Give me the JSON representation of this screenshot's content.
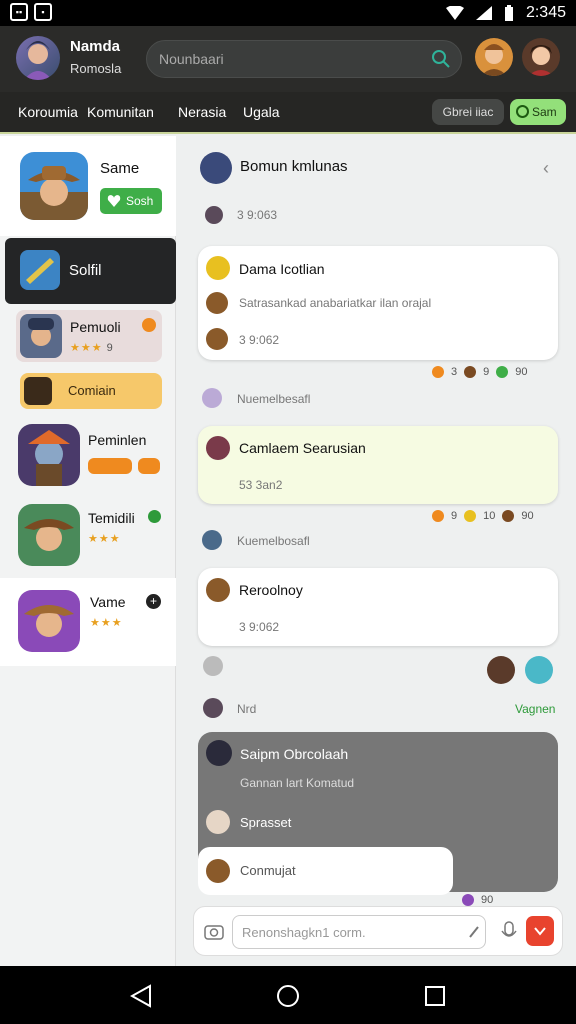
{
  "status": {
    "time": "2:345"
  },
  "header": {
    "title": "Namda",
    "subtitle": "Romosla",
    "search_placeholder": "Nounbaari"
  },
  "nav": {
    "tabs": [
      "Koroumia",
      "Komunitan",
      "Nerasia",
      "Ugala"
    ],
    "btn1": "Gbrei iiac",
    "btn2": "Sam"
  },
  "sidebar": {
    "items": [
      {
        "title": "Same",
        "badge": "Sosh"
      },
      {
        "title": "Solfil"
      },
      {
        "title": "Pemuoli",
        "rating": "9"
      },
      {
        "title": "Comiain"
      },
      {
        "title": "Peminlen"
      },
      {
        "title": "Temidili"
      },
      {
        "title": "Vame"
      }
    ]
  },
  "main": {
    "group_title": "Bomun kmlunas",
    "time1": "3 9:063",
    "msg1": {
      "title": "Dama Icotlian",
      "body": "Satrasankad anabariatkar ilan orajal",
      "time": "3 9:062"
    },
    "react1": [
      "3",
      "9",
      "90"
    ],
    "section2": "Nuemelbesafl",
    "msg2": {
      "title": "Camlaem Searusian",
      "time": "53 3an2"
    },
    "react2": [
      "9",
      "10",
      "90"
    ],
    "section3": "Kuemelbosafl",
    "msg3": {
      "title": "Reroolnoy",
      "time": "3 9:062"
    },
    "section4": "Nrd",
    "section4_link": "Vagnen",
    "msg4": {
      "title": "Saipm Obrcolaah",
      "body": "Gannan lart Komatud",
      "reply": "Sprasset"
    },
    "msg5": "Conmujat",
    "react5": "90",
    "composer_placeholder": "Renonshagkn1 corm."
  },
  "colors": {
    "accent_green": "#93e07a",
    "send_red": "#e8432e"
  }
}
